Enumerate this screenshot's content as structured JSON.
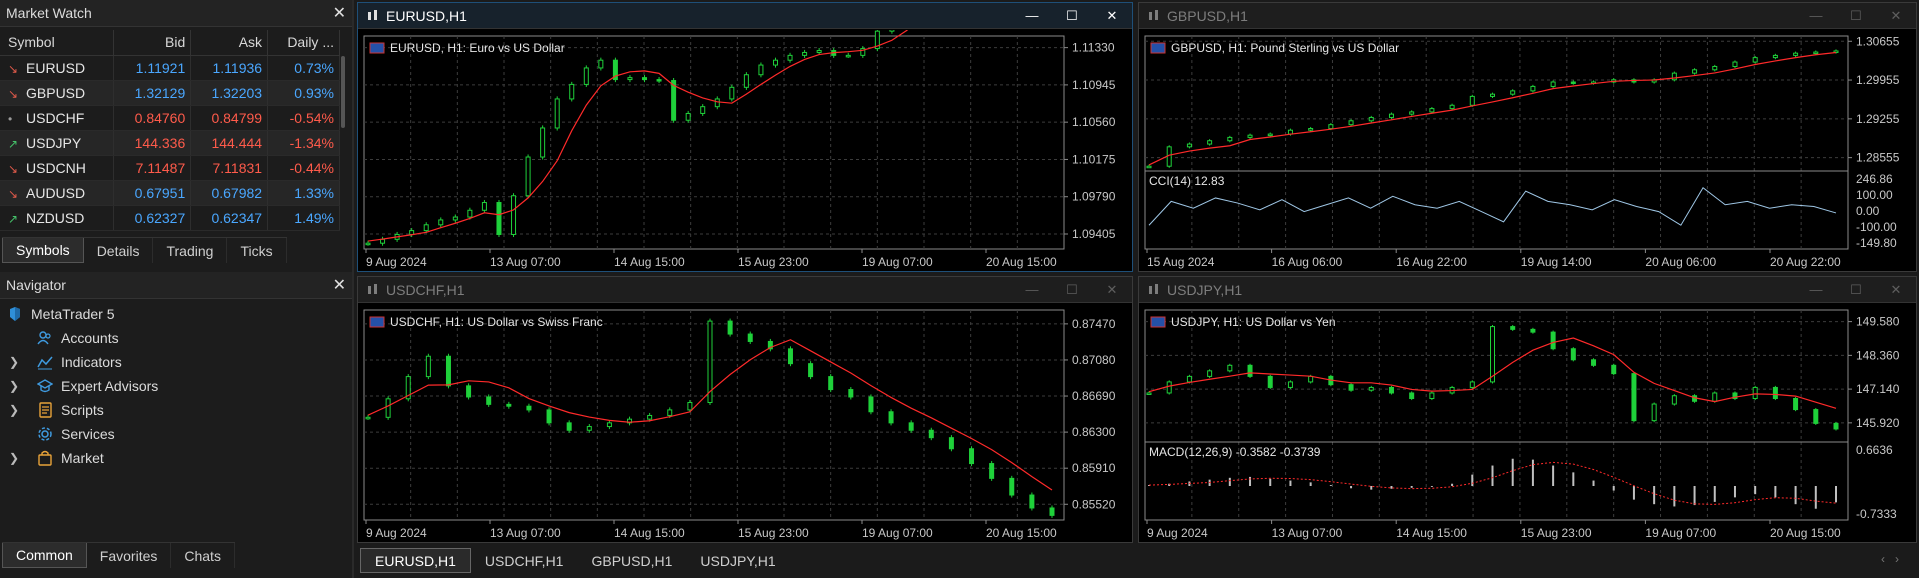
{
  "market_watch": {
    "title": "Market Watch",
    "columns": [
      "Symbol",
      "Bid",
      "Ask",
      "Daily ..."
    ],
    "rows": [
      {
        "symbol": "EURUSD",
        "bid": "1.11921",
        "ask": "1.11936",
        "daily": "0.73%",
        "dir": "down",
        "bid_color": "pos",
        "daily_color": "pos"
      },
      {
        "symbol": "GBPUSD",
        "bid": "1.32129",
        "ask": "1.32203",
        "daily": "0.93%",
        "dir": "down",
        "bid_color": "pos",
        "daily_color": "pos"
      },
      {
        "symbol": "USDCHF",
        "bid": "0.84760",
        "ask": "0.84799",
        "daily": "-0.54%",
        "dir": "neutral",
        "bid_color": "neg",
        "daily_color": "neg"
      },
      {
        "symbol": "USDJPY",
        "bid": "144.336",
        "ask": "144.444",
        "daily": "-1.34%",
        "dir": "up",
        "bid_color": "neg",
        "daily_color": "neg"
      },
      {
        "symbol": "USDCNH",
        "bid": "7.11487",
        "ask": "7.11831",
        "daily": "-0.44%",
        "dir": "down",
        "bid_color": "neg",
        "daily_color": "neg"
      },
      {
        "symbol": "AUDUSD",
        "bid": "0.67951",
        "ask": "0.67982",
        "daily": "1.33%",
        "dir": "down",
        "bid_color": "pos",
        "daily_color": "pos"
      },
      {
        "symbol": "NZDUSD",
        "bid": "0.62327",
        "ask": "0.62347",
        "daily": "1.49%",
        "dir": "up",
        "bid_color": "pos",
        "daily_color": "pos"
      }
    ],
    "tabs": [
      "Symbols",
      "Details",
      "Trading",
      "Ticks"
    ]
  },
  "navigator": {
    "title": "Navigator",
    "items": [
      {
        "label": "MetaTrader 5",
        "level": 0,
        "icon": "metatrader-icon"
      },
      {
        "label": "Accounts",
        "level": 1,
        "icon": "accounts-icon"
      },
      {
        "label": "Indicators",
        "level": 1,
        "icon": "indicators-icon",
        "expandable": true
      },
      {
        "label": "Expert Advisors",
        "level": 1,
        "icon": "expert-advisors-icon",
        "expandable": true
      },
      {
        "label": "Scripts",
        "level": 1,
        "icon": "scripts-icon",
        "expandable": true
      },
      {
        "label": "Services",
        "level": 1,
        "icon": "services-icon"
      },
      {
        "label": "Market",
        "level": 1,
        "icon": "market-icon",
        "expandable": true
      }
    ],
    "tabs": [
      "Common",
      "Favorites",
      "Chats"
    ]
  },
  "colors": {
    "bull": "#1fd13a",
    "bear": "#1fd13a",
    "ma": "#ff2a2a",
    "grid": "#3c3c3c",
    "axis_text": "#c8c8c8",
    "accent": "#4aa7ff"
  },
  "charts": [
    {
      "id": "eurusd",
      "title": "EURUSD,H1",
      "label": "EURUSD, H1:  Euro vs US Dollar",
      "active": true,
      "price_labels": [
        "1.11330",
        "1.10945",
        "1.10560",
        "1.10175",
        "1.09790",
        "1.09405"
      ],
      "time_labels": [
        "9 Aug 2024",
        "13 Aug 07:00",
        "14 Aug 15:00",
        "15 Aug 23:00",
        "19 Aug 07:00",
        "20 Aug 15:00"
      ],
      "ylim": [
        1.0925,
        1.1145
      ],
      "series": [
        1.0931,
        1.0935,
        1.094,
        1.0944,
        1.095,
        1.0955,
        1.0958,
        1.0965,
        1.0973,
        1.094,
        1.098,
        1.102,
        1.105,
        1.108,
        1.1095,
        1.1112,
        1.112,
        1.11,
        1.1102,
        1.11,
        1.1099,
        1.1058,
        1.1065,
        1.1072,
        1.108,
        1.1092,
        1.1105,
        1.1115,
        1.112,
        1.1125,
        1.1128,
        1.113,
        1.1125,
        1.1125,
        1.1132,
        1.115,
        1.116,
        1.1175,
        1.1185,
        1.1199,
        1.1218,
        1.124,
        1.1258,
        1.1268,
        1.1276,
        1.13,
        1.1318,
        1.1332
      ]
    },
    {
      "id": "gbpusd",
      "title": "GBPUSD,H1",
      "label": "GBPUSD, H1:  Pound Sterling vs US Dollar",
      "active": false,
      "price_labels": [
        "1.30655",
        "1.29955",
        "1.29255",
        "1.28555"
      ],
      "time_labels": [
        "15 Aug 2024",
        "16 Aug 06:00",
        "16 Aug 22:00",
        "19 Aug 14:00",
        "20 Aug 06:00",
        "20 Aug 22:00"
      ],
      "ylim": [
        1.2835,
        1.3075
      ],
      "series": [
        1.284,
        1.2875,
        1.288,
        1.2886,
        1.2892,
        1.2896,
        1.2898,
        1.2905,
        1.2908,
        1.2915,
        1.2922,
        1.2928,
        1.2934,
        1.2938,
        1.2944,
        1.295,
        1.2966,
        1.297,
        1.2976,
        1.2984,
        1.2992,
        1.299,
        1.2992,
        1.2996,
        1.2992,
        1.2996,
        1.3008,
        1.3014,
        1.302,
        1.3028,
        1.3036,
        1.304,
        1.3044,
        1.3046,
        1.3048
      ],
      "indicator": {
        "label": "CCI(14) 12.83",
        "scale_labels": [
          "246.86",
          "100.00",
          "0.00",
          "-100.00",
          "-149.80"
        ],
        "values": [
          -60,
          80,
          40,
          100,
          70,
          30,
          90,
          20,
          60,
          100,
          40,
          110,
          60,
          40,
          80,
          20,
          -40,
          140,
          80,
          60,
          30,
          90,
          50,
          20,
          -60,
          160,
          60,
          80,
          40,
          60,
          50,
          12
        ]
      }
    },
    {
      "id": "usdchf",
      "title": "USDCHF,H1",
      "label": "USDCHF, H1:  US Dollar vs Swiss Franc",
      "active": false,
      "price_labels": [
        "0.87470",
        "0.87080",
        "0.86690",
        "0.86300",
        "0.85910",
        "0.85520"
      ],
      "time_labels": [
        "9 Aug 2024",
        "13 Aug 07:00",
        "14 Aug 15:00",
        "15 Aug 23:00",
        "19 Aug 07:00",
        "20 Aug 15:00"
      ],
      "ylim": [
        0.8535,
        0.8762
      ],
      "series": [
        0.8646,
        0.8666,
        0.869,
        0.8712,
        0.868,
        0.8668,
        0.866,
        0.8658,
        0.8654,
        0.864,
        0.8632,
        0.8636,
        0.864,
        0.8644,
        0.8648,
        0.8654,
        0.8662,
        0.875,
        0.8736,
        0.8728,
        0.872,
        0.8704,
        0.869,
        0.8676,
        0.8668,
        0.8652,
        0.864,
        0.8632,
        0.8624,
        0.8612,
        0.8596,
        0.858,
        0.8562,
        0.8548,
        0.854
      ]
    },
    {
      "id": "usdjpy",
      "title": "USDJPY,H1",
      "label": "USDJPY, H1:  US Dollar vs Yen",
      "active": false,
      "price_labels": [
        "149.580",
        "148.360",
        "147.140",
        "145.920"
      ],
      "time_labels": [
        "9 Aug 2024",
        "13 Aug 07:00",
        "14 Aug 15:00",
        "15 Aug 23:00",
        "19 Aug 07:00",
        "20 Aug 15:00"
      ],
      "ylim": [
        145.3,
        150.0
      ],
      "series": [
        147.0,
        147.4,
        147.6,
        147.8,
        148.0,
        147.6,
        147.2,
        147.4,
        147.6,
        147.3,
        147.1,
        147.2,
        147.0,
        146.8,
        147.0,
        147.2,
        147.4,
        149.4,
        149.3,
        149.2,
        148.6,
        148.2,
        148.0,
        147.7,
        146.0,
        146.6,
        146.9,
        146.7,
        147.0,
        146.8,
        147.2,
        146.8,
        146.4,
        145.9,
        145.7
      ],
      "indicator": {
        "label": "MACD(12,26,9) -0.3582 -0.3739",
        "scale_labels": [
          "0.6636",
          "-0.7333"
        ],
        "values": [
          0.02,
          0.05,
          0.1,
          0.14,
          0.18,
          0.2,
          0.16,
          0.12,
          0.08,
          0.02,
          -0.05,
          -0.08,
          -0.06,
          -0.04,
          -0.02,
          0.05,
          0.25,
          0.45,
          0.6,
          0.58,
          0.45,
          0.3,
          0.12,
          -0.1,
          -0.3,
          -0.4,
          -0.45,
          -0.42,
          -0.35,
          -0.25,
          -0.18,
          -0.25,
          -0.4,
          -0.5,
          -0.36
        ]
      }
    }
  ],
  "chart_tabs": [
    "EURUSD,H1",
    "USDCHF,H1",
    "GBPUSD,H1",
    "USDJPY,H1"
  ],
  "chart_tabs_active": 0
}
